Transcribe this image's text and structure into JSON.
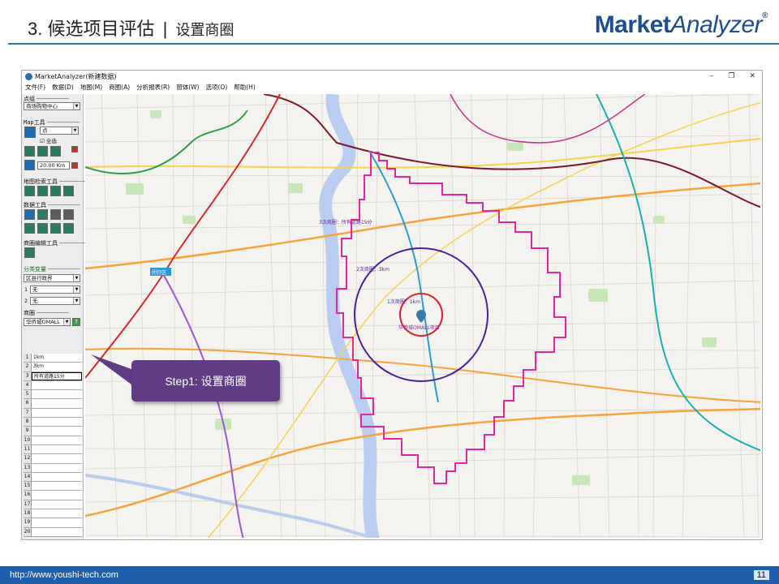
{
  "slide": {
    "title_main": "3. 候选项目评估",
    "separator": "|",
    "title_sub": "设置商圈",
    "brand_strong": "Market",
    "brand_light": "Analyzer",
    "brand_reg": "®"
  },
  "window": {
    "title": "MarketAnalyzer(新建数据)",
    "controls": [
      "–",
      "❐",
      "✕"
    ],
    "menu": [
      "文件(F)",
      "数据(D)",
      "地图(M)",
      "商圈(A)",
      "分析报表(R)",
      "窗体(W)",
      "选项(O)",
      "帮助(H)"
    ]
  },
  "panel": {
    "point_group_label": "点组",
    "point_group_value": "商场购物中心",
    "map_tools_label": "Map工具",
    "map_tool_select": "点",
    "select_all_label": "全选",
    "select_all_checked": true,
    "distance_value": "20.00",
    "distance_unit": "Km",
    "map_search_label": "地图检索工具",
    "data_tools_label": "数据工具",
    "tradearea_edit_label": "商圈编辑工具",
    "classify_label": "分类变量",
    "classify_value": "区县行政界",
    "var1_num": "1",
    "var1_value": "无",
    "var2_num": "2",
    "var2_value": "无",
    "tradearea_label": "商圈",
    "tradearea_select": "华侨城OMALL",
    "help_icon_text": "?",
    "rows": [
      {
        "num": "1",
        "val": "1km"
      },
      {
        "num": "2",
        "val": "3km"
      },
      {
        "num": "3",
        "val": "所有道路15分",
        "selected": true
      },
      {
        "num": "4",
        "val": ""
      },
      {
        "num": "5",
        "val": ""
      },
      {
        "num": "6",
        "val": ""
      },
      {
        "num": "7",
        "val": ""
      },
      {
        "num": "8",
        "val": ""
      },
      {
        "num": "9",
        "val": ""
      },
      {
        "num": "10",
        "val": ""
      },
      {
        "num": "11",
        "val": ""
      },
      {
        "num": "12",
        "val": ""
      },
      {
        "num": "13",
        "val": ""
      },
      {
        "num": "14",
        "val": ""
      },
      {
        "num": "15",
        "val": ""
      },
      {
        "num": "16",
        "val": ""
      },
      {
        "num": "17",
        "val": ""
      },
      {
        "num": "18",
        "val": ""
      },
      {
        "num": "19",
        "val": ""
      },
      {
        "num": "20",
        "val": ""
      }
    ]
  },
  "map": {
    "district_label": "闵行区",
    "label_15min": "3次商圈：所有道路15分",
    "label_3km": "2次商圈：3km",
    "label_1km": "1次商圈：1km",
    "project_label": "华侨城OMALL项目",
    "colors": {
      "ring_1km": "#e0202a",
      "ring_3km": "#4a1fa0",
      "polygon_15min": "#e8259a",
      "river": "#b8cdf0",
      "metro_blue": "#2b9bd6",
      "metro_red": "#d62a2a",
      "metro_brown": "#7a1a2a",
      "metro_teal": "#17b0b0",
      "metro_purple": "#9a55d8",
      "metro_green": "#2aa048",
      "road_orange": "#f7a23c",
      "road_yellow": "#f7d24c"
    }
  },
  "callout": {
    "text": "Step1:  设置商圈"
  },
  "footer": {
    "url": "http://www.youshi-tech.com",
    "page": "11"
  }
}
